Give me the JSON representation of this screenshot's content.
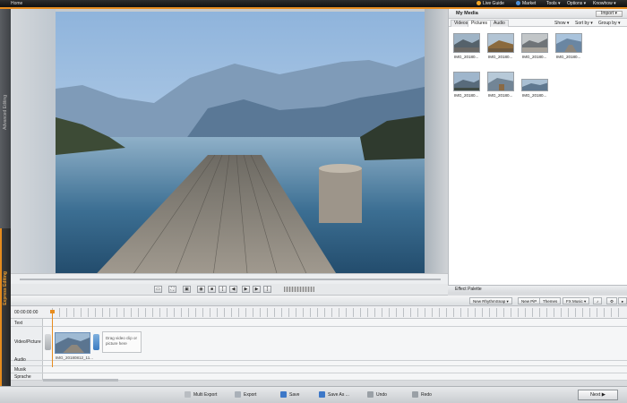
{
  "topbar": {
    "home": "Home",
    "live_guide": "Live Guide",
    "market": "Market",
    "tools": "Tools ▾",
    "options": "Options ▾",
    "knowhow": "Knowhow ▾"
  },
  "left_tabs": {
    "advanced": "Advanced Editing",
    "express": "Express Editing"
  },
  "media": {
    "title": "My Media",
    "import": "Import ▾",
    "tabs": [
      "Videos",
      "Pictures",
      "Audio"
    ],
    "active_tab": "Pictures",
    "controls": {
      "show": "Show ▾",
      "sort": "Sort by ▾",
      "group": "Group by ▾"
    },
    "thumbs": [
      {
        "label": "IMG_20180..."
      },
      {
        "label": "IMG_20180..."
      },
      {
        "label": "IMG_20180..."
      },
      {
        "label": "IMG_20180..."
      },
      {
        "label": "IMG_20180..."
      },
      {
        "label": "IMG_20180..."
      },
      {
        "label": "IMG_20180..."
      }
    ]
  },
  "effect_palette": "Effect Palette",
  "timeline_toolbar": {
    "rhythm": "New RhythmSnap ▾",
    "pip": "New PiP",
    "themes": "Themes",
    "fx": "FX Music ▾"
  },
  "timeline": {
    "timecode": "00:00:00:00",
    "tracks": [
      "Text",
      "Video/Picture",
      "Audio",
      "Musik",
      "Sprache"
    ],
    "clip_name": "IMG_20180812_11...",
    "drop_hint": "Drag video clip or picture here"
  },
  "bottom": {
    "multi_export": "Multi Export",
    "export": "Export",
    "save": "Save",
    "save_as": "Save As ...",
    "undo": "Undo",
    "redo": "Redo",
    "next": "Next"
  },
  "colors": {
    "accent": "#e78c1e",
    "clip_border": "#6a8fb8"
  }
}
